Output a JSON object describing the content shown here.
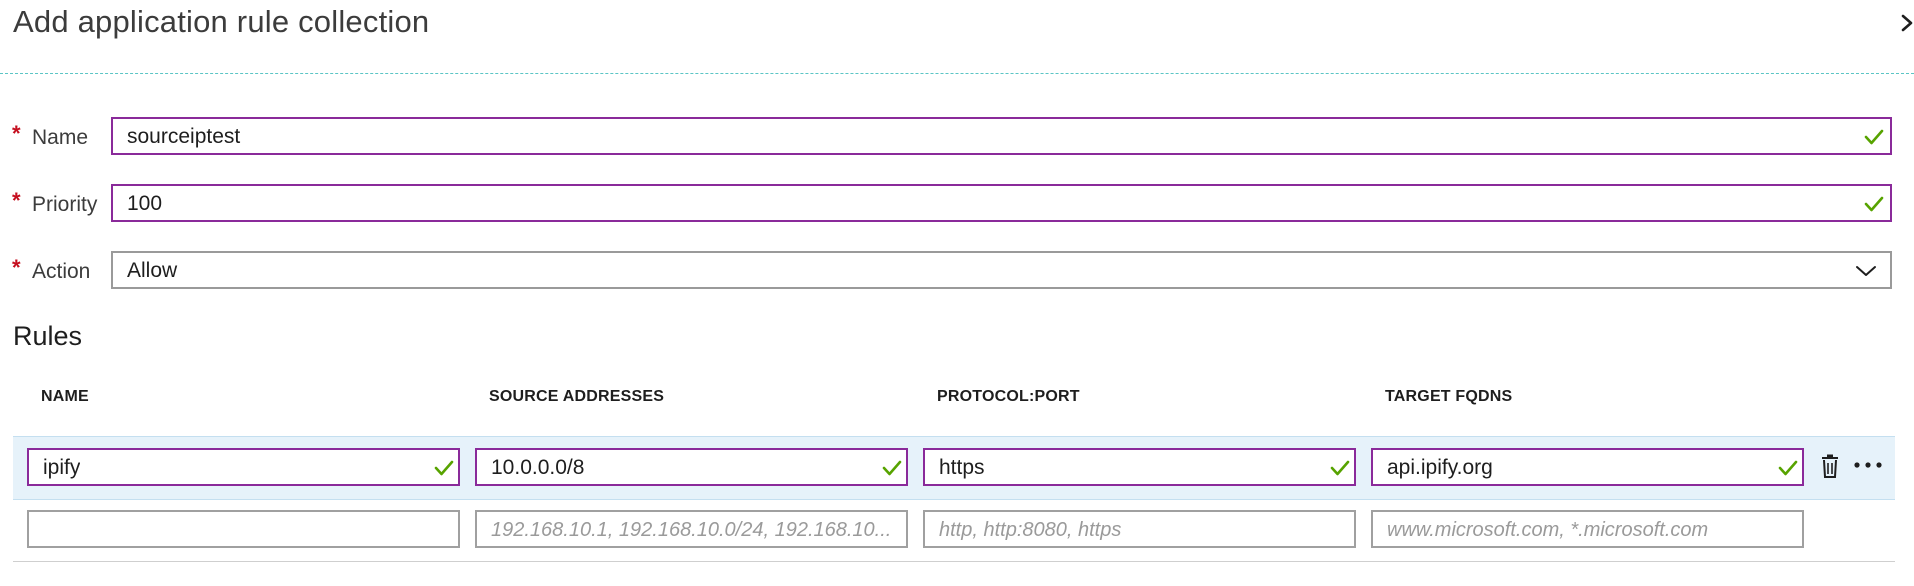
{
  "blade": {
    "title": "Add application rule collection"
  },
  "form": {
    "name": {
      "label": "Name",
      "value": "sourceiptest",
      "valid": true
    },
    "priority": {
      "label": "Priority",
      "value": "100",
      "valid": true
    },
    "action": {
      "label": "Action",
      "value": "Allow"
    }
  },
  "rules": {
    "title": "Rules",
    "columns": [
      "NAME",
      "SOURCE ADDRESSES",
      "PROTOCOL:PORT",
      "TARGET FQDNS"
    ],
    "rows": [
      {
        "name": "ipify",
        "source_addresses": "10.0.0.0/8",
        "protocol_port": "https",
        "target_fqdns": "api.ipify.org"
      }
    ],
    "new_row_placeholders": {
      "name": "",
      "source_addresses": "192.168.10.1, 192.168.10.0/24, 192.168.10...",
      "protocol_port": "http, http:8080, https",
      "target_fqdns": "www.microsoft.com, *.microsoft.com"
    }
  },
  "colors": {
    "valid_border": "#8a2a9a",
    "valid_check": "#57a300",
    "required_star": "#c50f1f",
    "selected_row": "#e6f2fa",
    "divider": "#5bc5c5"
  },
  "icons": {
    "close": "close-icon",
    "valid": "check-icon",
    "dropdown": "chevron-down-icon",
    "delete": "trash-icon",
    "more": "more-icon"
  }
}
